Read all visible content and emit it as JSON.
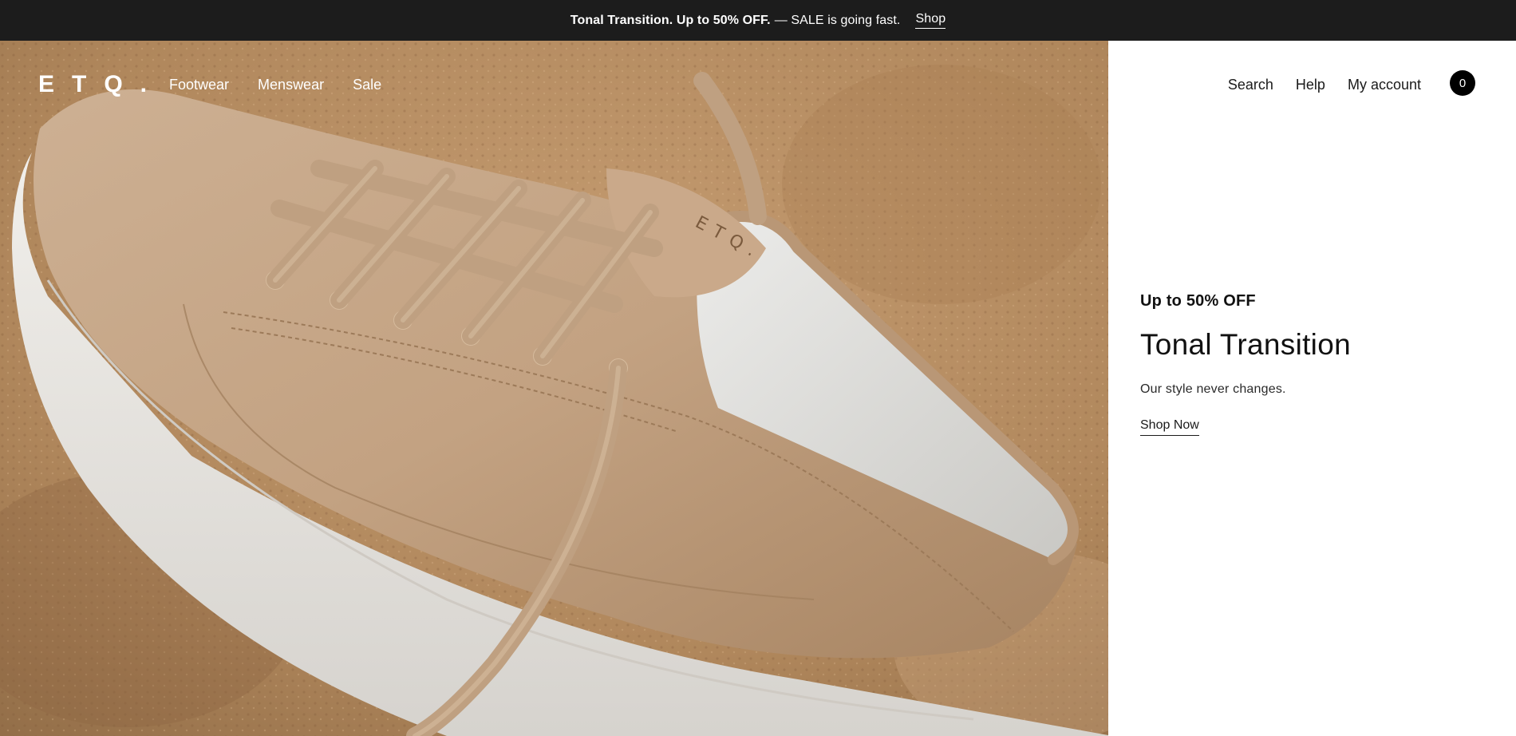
{
  "announcement": {
    "bold_text": "Tonal Transition. Up to 50% OFF.",
    "text": "— SALE is going fast.",
    "link_label": "Shop"
  },
  "header": {
    "logo": "ETQ.",
    "nav": [
      "Footwear",
      "Menswear",
      "Sale"
    ],
    "utility": [
      "Search",
      "Help",
      "My account"
    ],
    "cart_count": "0"
  },
  "promo": {
    "eyebrow": "Up to 50% OFF",
    "headline": "Tonal Transition",
    "subtitle": "Our style never changes.",
    "cta": "Shop Now"
  },
  "hero": {
    "image": "sneaker-on-rock",
    "colors": {
      "rock": "#b88e64",
      "suede": "#c4a385",
      "sole": "#e9e7e3",
      "lining": "#d9d9d6"
    }
  },
  "colors": {
    "announcement_bg": "#1c1c1c",
    "cart_badge": "#000000"
  }
}
